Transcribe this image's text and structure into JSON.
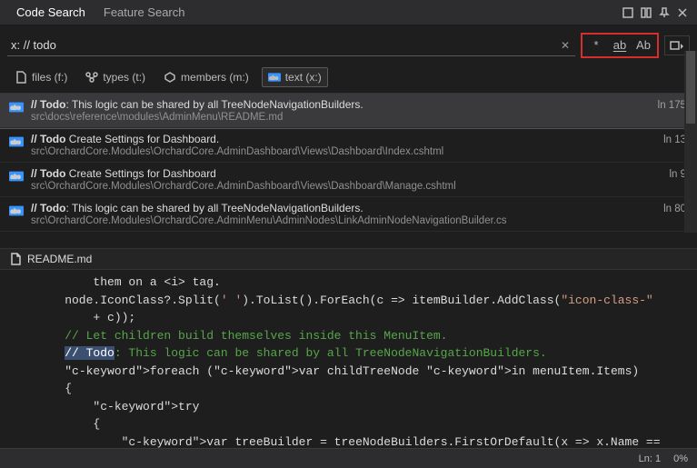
{
  "titlebar": {
    "tab_active": "Code Search",
    "tab_inactive": "Feature Search"
  },
  "search": {
    "value": "x: // todo",
    "options": {
      "glob": "*",
      "whole_word": "ab",
      "match_case": "Ab"
    }
  },
  "filters": [
    {
      "label": "files (f:)",
      "icon": "file-icon",
      "active": false
    },
    {
      "label": "types (t:)",
      "icon": "types-icon",
      "active": false
    },
    {
      "label": "members (m:)",
      "icon": "member-icon",
      "active": false
    },
    {
      "label": "text (x:)",
      "icon": "text-filter-icon",
      "active": true
    }
  ],
  "results": [
    {
      "prefix": "// Todo",
      "rest": ": This logic can be shared by all TreeNodeNavigationBuilders.",
      "path": "src\\docs\\reference\\modules\\AdminMenu\\README.md",
      "line": "ln 175",
      "selected": true
    },
    {
      "prefix": "// Todo",
      "rest": " Create Settings for Dashboard.",
      "path": "src\\OrchardCore.Modules\\OrchardCore.AdminDashboard\\Views\\Dashboard\\Index.cshtml",
      "line": "ln 13",
      "selected": false
    },
    {
      "prefix": "// Todo",
      "rest": " Create Settings for Dashboard",
      "path": "src\\OrchardCore.Modules\\OrchardCore.AdminDashboard\\Views\\Dashboard\\Manage.cshtml",
      "line": "ln 9",
      "selected": false
    },
    {
      "prefix": "// Todo",
      "rest": ": This logic can be shared by all TreeNodeNavigationBuilders.",
      "path": "src\\OrchardCore.Modules\\OrchardCore.AdminMenu\\AdminNodes\\LinkAdminNodeNavigationBuilder.cs",
      "line": "ln 80",
      "selected": false
    }
  ],
  "preview": {
    "filename": "README.md",
    "highlight": "// Todo",
    "lines": [
      "        them on a <i> tag.",
      "    node.IconClass?.Split(' ').ToList().ForEach(c => itemBuilder.AddClass(\"icon-class-\"",
      "        + c));",
      "",
      "    // Let children build themselves inside this MenuItem.",
      "    // Todo: This logic can be shared by all TreeNodeNavigationBuilders.",
      "    foreach (var childTreeNode in menuItem.Items)",
      "    {",
      "        try",
      "        {",
      "            var treeBuilder = treeNodeBuilders.FirstOrDefault(x => x.Name =="
    ]
  },
  "statusbar": {
    "pos": "Ln: 1",
    "pct": "0%"
  }
}
